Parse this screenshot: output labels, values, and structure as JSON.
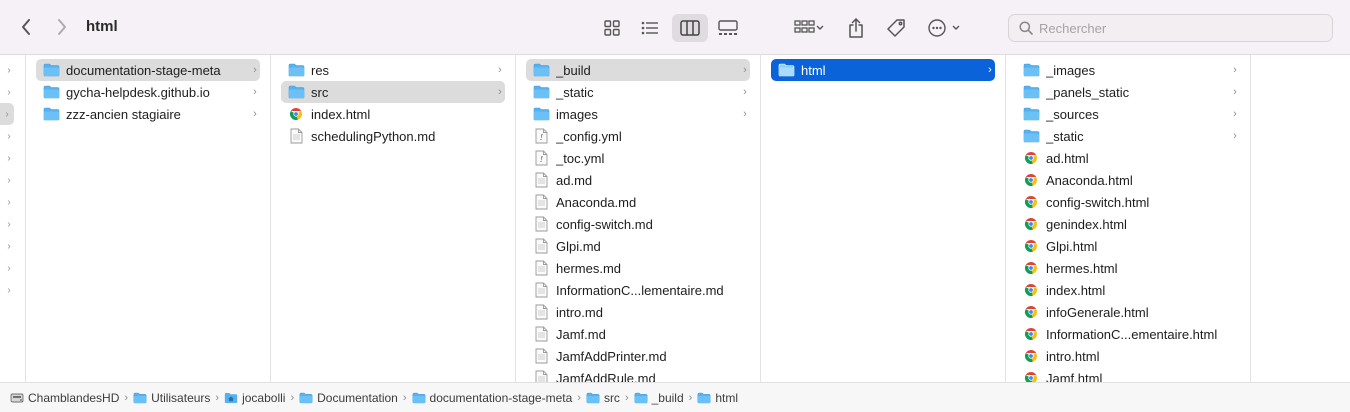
{
  "window": {
    "title": "html"
  },
  "search": {
    "placeholder": "Rechercher"
  },
  "columns": {
    "col1": [
      {
        "label": "documentation-stage-meta",
        "type": "folder",
        "chevron": true,
        "selected": "grey"
      },
      {
        "label": "gycha-helpdesk.github.io",
        "type": "folder",
        "chevron": true
      },
      {
        "label": "zzz-ancien stagiaire",
        "type": "folder",
        "chevron": true
      }
    ],
    "col2": [
      {
        "label": "res",
        "type": "folder",
        "chevron": true
      },
      {
        "label": "src",
        "type": "folder",
        "chevron": true,
        "selected": "grey"
      },
      {
        "label": "index.html",
        "type": "html"
      },
      {
        "label": "schedulingPython.md",
        "type": "doc"
      }
    ],
    "col3": [
      {
        "label": "_build",
        "type": "folder",
        "chevron": true,
        "selected": "grey"
      },
      {
        "label": "_static",
        "type": "folder",
        "chevron": true
      },
      {
        "label": "images",
        "type": "folder",
        "chevron": true
      },
      {
        "label": "_config.yml",
        "type": "yml"
      },
      {
        "label": "_toc.yml",
        "type": "yml"
      },
      {
        "label": "ad.md",
        "type": "doc"
      },
      {
        "label": "Anaconda.md",
        "type": "doc"
      },
      {
        "label": "config-switch.md",
        "type": "doc"
      },
      {
        "label": "Glpi.md",
        "type": "doc"
      },
      {
        "label": "hermes.md",
        "type": "doc"
      },
      {
        "label": "InformationC...lementaire.md",
        "type": "doc"
      },
      {
        "label": "intro.md",
        "type": "doc"
      },
      {
        "label": "Jamf.md",
        "type": "doc"
      },
      {
        "label": "JamfAddPrinter.md",
        "type": "doc"
      },
      {
        "label": "JamfAddRule.md",
        "type": "doc"
      }
    ],
    "col4": [
      {
        "label": "html",
        "type": "folder",
        "chevron": true,
        "selected": "blue"
      }
    ],
    "col5": [
      {
        "label": "_images",
        "type": "folder",
        "chevron": true
      },
      {
        "label": "_panels_static",
        "type": "folder",
        "chevron": true
      },
      {
        "label": "_sources",
        "type": "folder",
        "chevron": true
      },
      {
        "label": "_static",
        "type": "folder",
        "chevron": true
      },
      {
        "label": "ad.html",
        "type": "html"
      },
      {
        "label": "Anaconda.html",
        "type": "html"
      },
      {
        "label": "config-switch.html",
        "type": "html"
      },
      {
        "label": "genindex.html",
        "type": "html"
      },
      {
        "label": "Glpi.html",
        "type": "html"
      },
      {
        "label": "hermes.html",
        "type": "html"
      },
      {
        "label": "index.html",
        "type": "html"
      },
      {
        "label": "infoGenerale.html",
        "type": "html"
      },
      {
        "label": "InformationC...ementaire.html",
        "type": "html"
      },
      {
        "label": "intro.html",
        "type": "html"
      },
      {
        "label": "Jamf.html",
        "type": "html"
      }
    ]
  },
  "pathbar": [
    {
      "label": "ChamblandesHD",
      "type": "disk"
    },
    {
      "label": "Utilisateurs",
      "type": "folder"
    },
    {
      "label": "jocabolli",
      "type": "home"
    },
    {
      "label": "Documentation",
      "type": "folder"
    },
    {
      "label": "documentation-stage-meta",
      "type": "folder"
    },
    {
      "label": "src",
      "type": "folder"
    },
    {
      "label": "_build",
      "type": "folder"
    },
    {
      "label": "html",
      "type": "folder"
    }
  ],
  "colors": {
    "selection_blue": "#0a63d9",
    "folder_blue": "#5ab3ef",
    "toolbar_bg": "#f6f1f6"
  },
  "icons": {
    "back": "chevron-left-icon",
    "forward": "chevron-right-icon",
    "views": [
      "icon-view-icon",
      "list-view-icon",
      "column-view-icon",
      "gallery-view-icon"
    ],
    "group": "group-by-icon",
    "share": "share-icon",
    "tag": "tag-icon",
    "more": "more-options-icon",
    "search": "search-icon"
  }
}
